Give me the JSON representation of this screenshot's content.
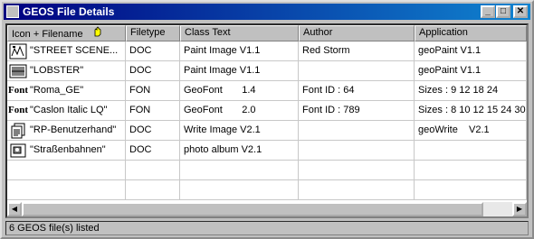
{
  "window": {
    "title": "GEOS File Details",
    "minimize": "_",
    "maximize": "□",
    "close": "✕"
  },
  "columns": [
    "Icon + Filename",
    "Filetype",
    "Class Text",
    "Author",
    "Application"
  ],
  "rows": [
    {
      "icon": "paint-image-icon",
      "filename": "\"STREET SCENE...",
      "filetype": "DOC",
      "class_text": "Paint Image V1.1",
      "author": "Red Storm",
      "application": "geoPaint    V1.1"
    },
    {
      "icon": "paint-image-icon",
      "filename": "\"LOBSTER\"",
      "filetype": "DOC",
      "class_text": "Paint Image V1.1",
      "author": "",
      "application": "geoPaint    V1.1"
    },
    {
      "icon": "font-icon",
      "icon_text": "Font",
      "filename": "\"Roma_GE\"",
      "filetype": "FON",
      "class_text": "GeoFont       1.4",
      "author": "Font ID : 64",
      "application": "Sizes : 9 12 18 24"
    },
    {
      "icon": "font-icon",
      "icon_text": "Font",
      "filename": "\"Caslon Italic LQ\"",
      "filetype": "FON",
      "class_text": "GeoFont       2.0",
      "author": "Font ID : 789",
      "application": "Sizes : 8 10 12 15 24 30"
    },
    {
      "icon": "write-doc-icon",
      "filename": "\"RP-Benutzerhand\"",
      "filetype": "DOC",
      "class_text": "Write Image V2.1",
      "author": "",
      "application": "geoWrite    V2.1"
    },
    {
      "icon": "photo-album-icon",
      "filename": "\"Straßenbahnen\"",
      "filetype": "DOC",
      "class_text": "photo album V2.1",
      "author": "",
      "application": ""
    }
  ],
  "status": "6 GEOS file(s) listed",
  "scroll": {
    "left_arrow": "◀",
    "right_arrow": "▶"
  }
}
